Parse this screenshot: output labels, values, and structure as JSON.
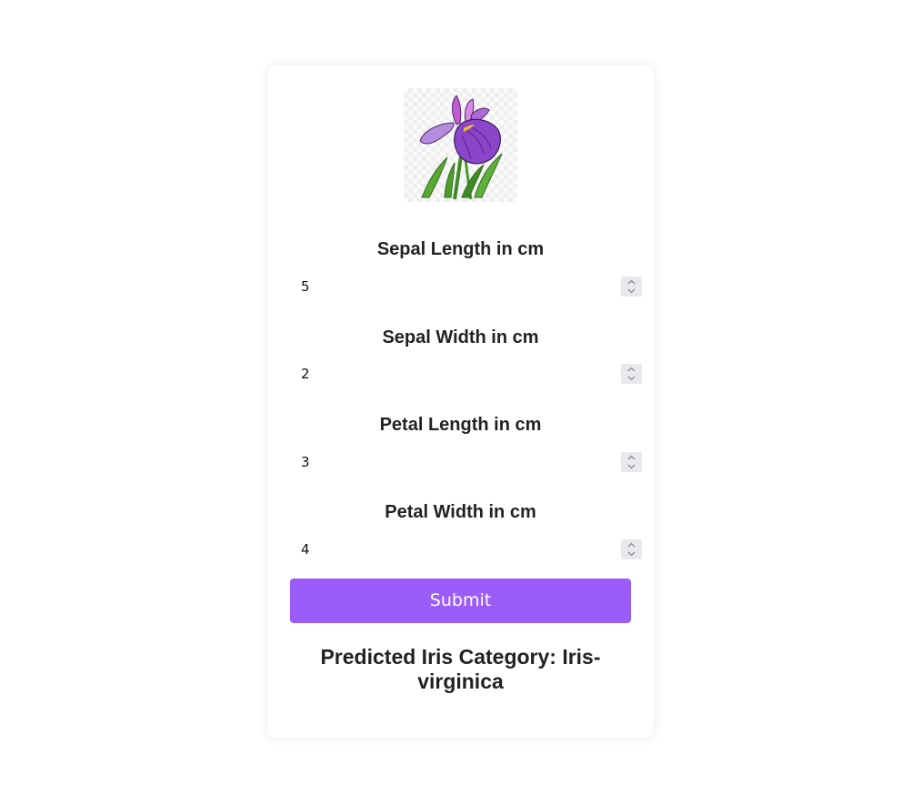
{
  "image": {
    "icon": "iris-flower-image"
  },
  "fields": [
    {
      "label": "Sepal Length in cm",
      "value": "5"
    },
    {
      "label": "Sepal Width in cm",
      "value": "2"
    },
    {
      "label": "Petal Length in cm",
      "value": "3"
    },
    {
      "label": "Petal Width in cm",
      "value": "4"
    }
  ],
  "submit_label": "Submit",
  "result_text": "Predicted Iris Category: Iris-virginica",
  "colors": {
    "accent": "#9b5cf7",
    "text": "#222222"
  }
}
